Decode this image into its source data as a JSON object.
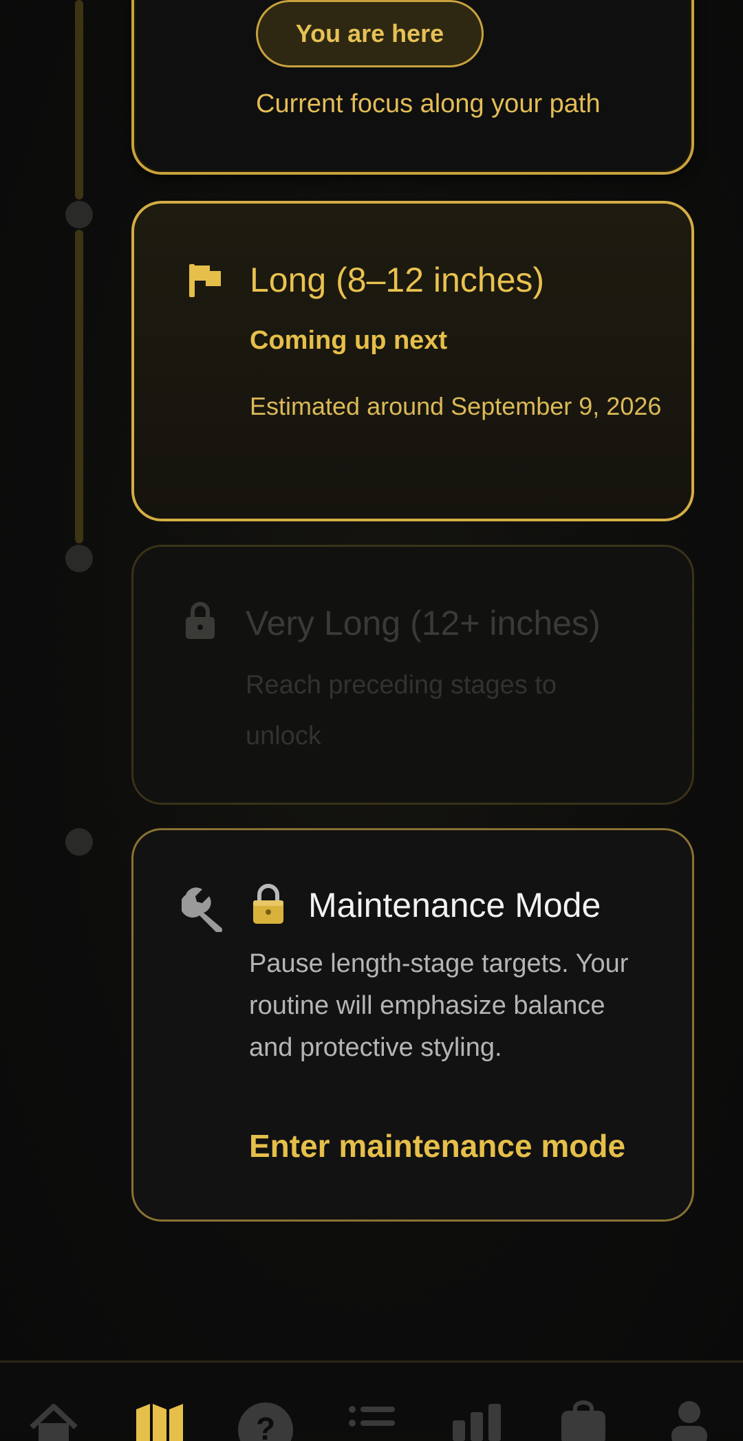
{
  "current_stage": {
    "badge": "You are here",
    "subtitle": "Current focus along your path"
  },
  "next_stage": {
    "icon": "flag-icon",
    "title": "Long (8–12 inches)",
    "kicker": "Coming up next",
    "estimate": "Estimated around September 9, 2026"
  },
  "locked_stage": {
    "icon": "lock-icon",
    "title": "Very Long (12+ inches)",
    "body": "Reach preceding stages to unlock"
  },
  "maintenance": {
    "icon": "wrench-icon",
    "emoji": "padlock-icon",
    "title": "Maintenance Mode",
    "body": "Pause length-stage targets. Your routine will emphasize balance and protective styling.",
    "action": "Enter maintenance mode"
  },
  "tabbar": {
    "tabs": [
      {
        "icon": "home-icon",
        "active": false
      },
      {
        "icon": "map-icon",
        "active": true
      },
      {
        "icon": "help-icon",
        "active": false
      },
      {
        "icon": "list-icon",
        "active": false
      },
      {
        "icon": "bar-chart-icon",
        "active": false
      },
      {
        "icon": "bag-icon",
        "active": false
      },
      {
        "icon": "profile-icon",
        "active": false
      }
    ]
  },
  "colors": {
    "accent": "#e6bf4a",
    "background": "#0d0d0c",
    "locked_text": "#3b3a36"
  }
}
